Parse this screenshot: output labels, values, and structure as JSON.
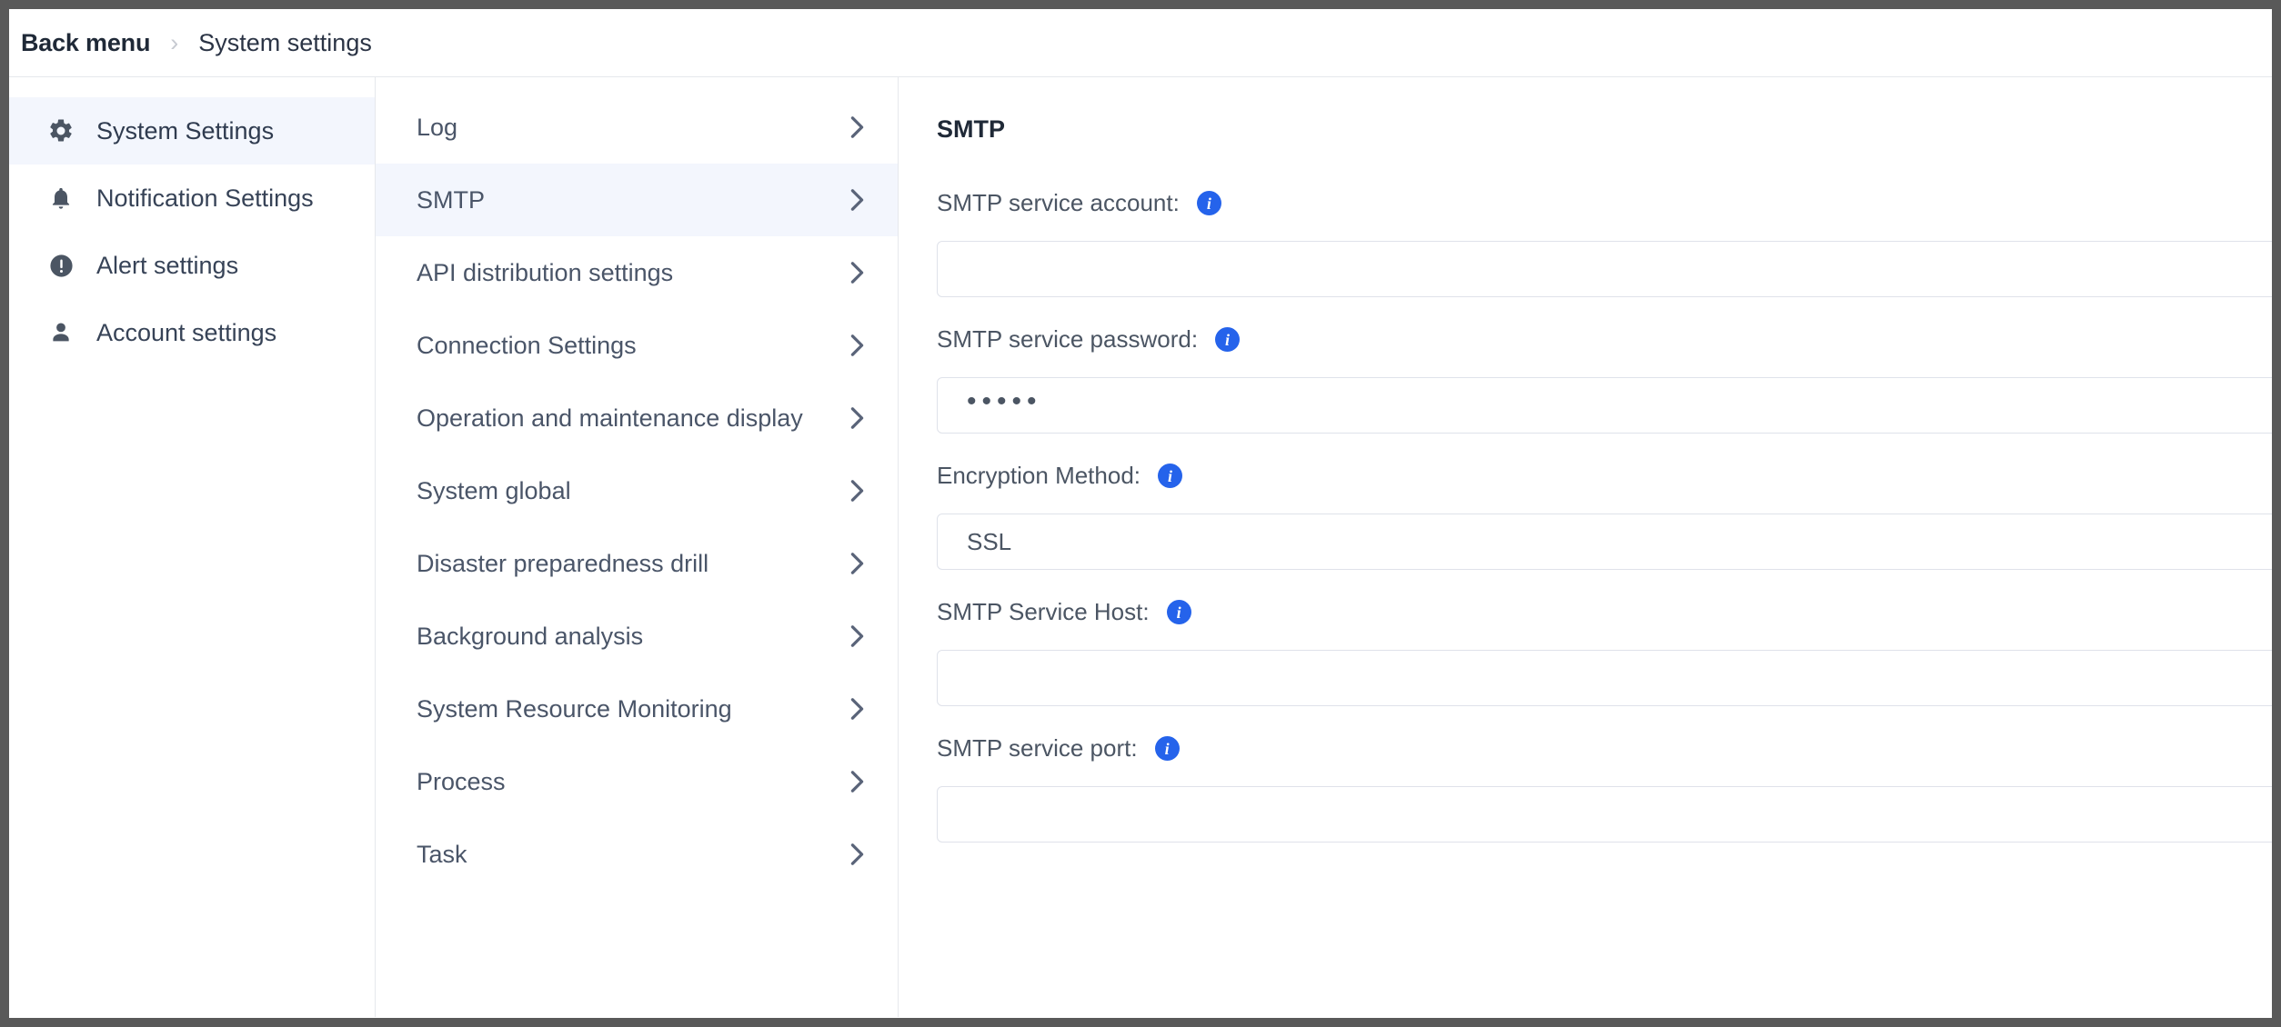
{
  "breadcrumb": {
    "root": "Back menu",
    "separator": "›",
    "current": "System settings"
  },
  "sidebar": {
    "items": [
      {
        "label": "System Settings",
        "icon": "gear-icon",
        "active": true
      },
      {
        "label": "Notification Settings",
        "icon": "bell-icon",
        "active": false
      },
      {
        "label": "Alert settings",
        "icon": "alert-icon",
        "active": false
      },
      {
        "label": "Account settings",
        "icon": "person-icon",
        "active": false
      }
    ]
  },
  "midlist": {
    "chevron": "›",
    "items": [
      {
        "label": "Log",
        "active": false
      },
      {
        "label": "SMTP",
        "active": true
      },
      {
        "label": "API distribution settings",
        "active": false
      },
      {
        "label": "Connection Settings",
        "active": false
      },
      {
        "label": "Operation and maintenance display",
        "active": false
      },
      {
        "label": "System global",
        "active": false
      },
      {
        "label": "Disaster preparedness drill",
        "active": false
      },
      {
        "label": "Background analysis",
        "active": false
      },
      {
        "label": "System Resource Monitoring",
        "active": false
      },
      {
        "label": "Process",
        "active": false
      },
      {
        "label": "Task",
        "active": false
      }
    ]
  },
  "detail": {
    "title": "SMTP",
    "info_glyph": "i",
    "fields": [
      {
        "label": "SMTP service account:",
        "value": "",
        "placeholder": "",
        "type": "text"
      },
      {
        "label": "SMTP service password:",
        "value": "•••••",
        "placeholder": "",
        "type": "password"
      },
      {
        "label": "Encryption Method:",
        "value": "SSL",
        "placeholder": "",
        "type": "select"
      },
      {
        "label": "SMTP Service Host:",
        "value": "",
        "placeholder": "",
        "type": "text"
      },
      {
        "label": "SMTP service port:",
        "value": "",
        "placeholder": "",
        "type": "text"
      }
    ]
  },
  "colors": {
    "accent": "#2563eb",
    "active_row": "#f3f6fd",
    "border": "#e6e8ec",
    "text": "#4a5568",
    "frame": "#595959"
  }
}
